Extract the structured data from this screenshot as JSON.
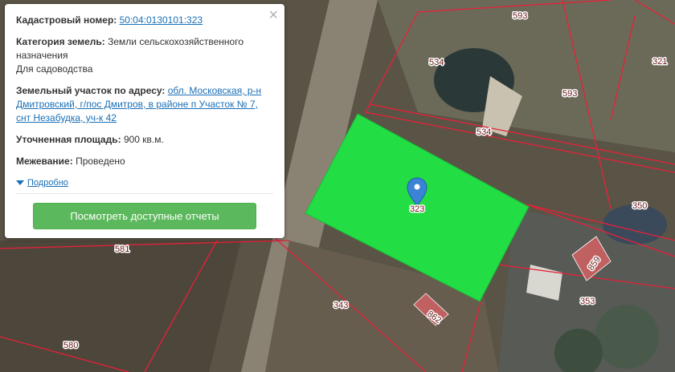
{
  "popup": {
    "cadastral_label": "Кадастровый номер:",
    "cadastral_value": "50:04:0130101:323",
    "category_label": "Категория земель:",
    "category_value_1": "Земли сельскохозяйственного назначения",
    "category_value_2": "Для садоводства",
    "address_label": "Земельный участок по адресу:",
    "address_value": "обл. Московская, р-н Дмитровский, г/пос Дмитров, в районе п Участок № 7, снт Незабудка, уч-к 42",
    "area_label": "Уточненная площадь:",
    "area_value": "900 кв.м.",
    "survey_label": "Межевание:",
    "survey_value": "Проведено",
    "details_link": "Подробно",
    "reports_button": "Посмотреть доступные отчеты",
    "close_symbol": "×"
  },
  "map": {
    "parcel_labels": {
      "p593_top": "593",
      "p534_a": "534",
      "p534_b": "534",
      "p593_right": "593",
      "p321": "321",
      "p350": "350",
      "p323": "323",
      "p581": "581",
      "p859": "859",
      "p353": "353",
      "p343": "343",
      "p862": "862",
      "p580": "580"
    },
    "selected_color": "#22dd44",
    "boundary_color": "#e8203a",
    "building_color": "#c06060"
  }
}
